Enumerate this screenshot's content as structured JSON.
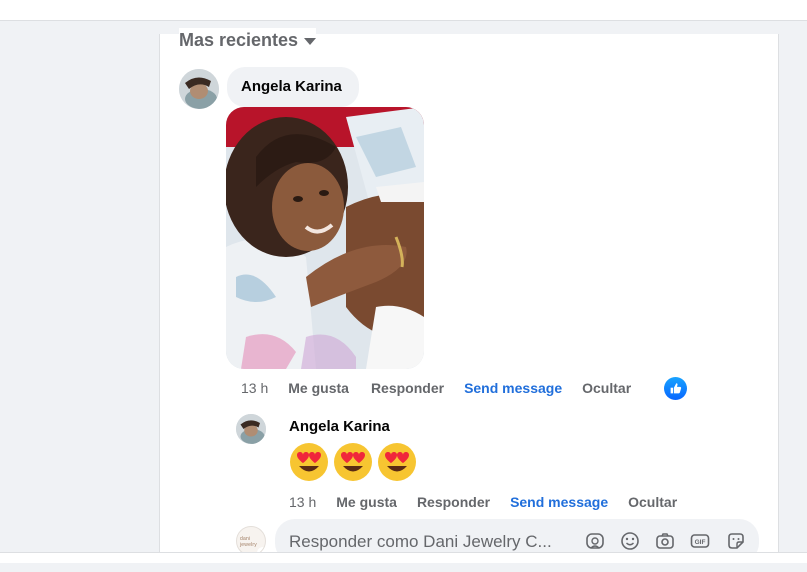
{
  "sort": {
    "label": "Mas recientes"
  },
  "comment": {
    "author": "Angela Karina",
    "time": "13 h",
    "like_label": "Me gusta",
    "reply_label": "Responder",
    "send_label": "Send message",
    "hide_label": "Ocultar",
    "reaction": "like"
  },
  "reply": {
    "author": "Angela Karina",
    "emoji_text": "😍😍😍",
    "time": "13 h",
    "like_label": "Me gusta",
    "reply_label": "Responder",
    "send_label": "Send message",
    "hide_label": "Ocultar"
  },
  "composer": {
    "placeholder": "Responder como Dani Jewelry C...",
    "avatar_text": "dani jewelry",
    "tools": [
      "avatar-sticker-icon",
      "emoji-icon",
      "camera-icon",
      "gif-icon",
      "sticker-icon"
    ]
  },
  "colors": {
    "link": "#216fdb",
    "like_badge": "#0866ff",
    "bubble": "#f0f2f5",
    "muted_text": "#65676b"
  }
}
